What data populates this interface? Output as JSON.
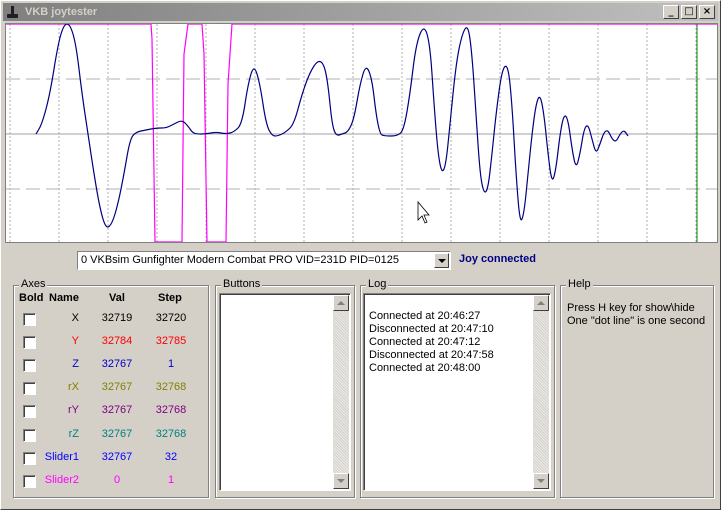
{
  "window": {
    "title": "VKB joytester"
  },
  "plot": {
    "colors": {
      "x": "#000080",
      "y": "#ff00ff",
      "marker": "#008000",
      "grid": "#a0a0a0"
    }
  },
  "device": {
    "selected": "0 VKBsim Gunfighter Modern Combat PRO  VID=231D PID=0125",
    "status": "Joy connected"
  },
  "axes": {
    "title": "Axes",
    "headers": {
      "bold": "Bold",
      "name": "Name",
      "val": "Val",
      "step": "Step"
    },
    "rows": [
      {
        "name": "X",
        "val": "32719",
        "step": "32720",
        "color": "#000000"
      },
      {
        "name": "Y",
        "val": "32784",
        "step": "32785",
        "color": "#ff0000"
      },
      {
        "name": "Z",
        "val": "32767",
        "step": "1",
        "color": "#0000c0"
      },
      {
        "name": "rX",
        "val": "32767",
        "step": "32768",
        "color": "#808000"
      },
      {
        "name": "rY",
        "val": "32767",
        "step": "32768",
        "color": "#800080"
      },
      {
        "name": "rZ",
        "val": "32767",
        "step": "32768",
        "color": "#008080"
      },
      {
        "name": "Slider1",
        "val": "32767",
        "step": "32",
        "color": "#0000ff"
      },
      {
        "name": "Slider2",
        "val": "0",
        "step": "1",
        "color": "#ff00ff"
      }
    ]
  },
  "buttons": {
    "title": "Buttons"
  },
  "log": {
    "title": "Log",
    "lines": [
      "Connected at 20:46:27",
      "Disconnected at 20:47:10",
      "Connected at 20:47:12",
      "Disconnected at 20:47:58",
      "Connected at 20:48:00"
    ]
  },
  "help": {
    "title": "Help",
    "lines": [
      "Press H key for show\\hide",
      "One \"dot line\" is one second"
    ]
  }
}
